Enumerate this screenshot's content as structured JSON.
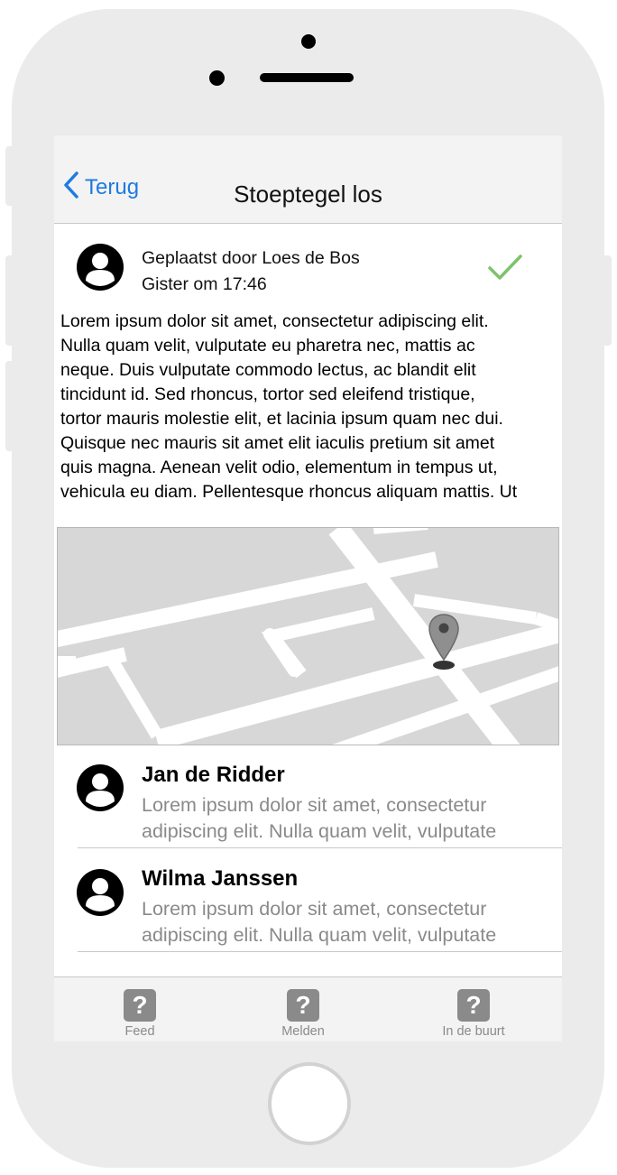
{
  "navbar": {
    "back_label": "Terug",
    "title": "Stoeptegel los"
  },
  "post": {
    "posted_by": "Geplaatst door Loes de Bos",
    "posted_at": "Gister om 17:46",
    "status": "resolved",
    "body_lines": [
      "Lorem ipsum dolor sit amet, consectetur adipiscing elit.",
      "Nulla quam velit, vulputate eu pharetra nec, mattis ac",
      "neque. Duis vulputate commodo lectus, ac blandit elit",
      "tincidunt id. Sed rhoncus, tortor sed eleifend tristique,",
      "tortor mauris molestie elit, et lacinia ipsum quam nec dui.",
      "Quisque nec mauris sit amet elit iaculis pretium sit amet",
      "quis magna. Aenean velit odio, elementum in tempus ut,",
      "vehicula eu diam. Pellentesque rhoncus aliquam mattis. Ut"
    ]
  },
  "comments": [
    {
      "name": "Jan de Ridder",
      "text_lines": [
        "Lorem ipsum dolor sit amet, consectetur",
        "adipiscing elit. Nulla quam velit, vulputate"
      ]
    },
    {
      "name": "Wilma Janssen",
      "text_lines": [
        "Lorem ipsum dolor sit amet, consectetur",
        "adipiscing elit. Nulla quam velit, vulputate"
      ]
    }
  ],
  "tabbar": {
    "tabs": [
      {
        "icon": "?",
        "label": "Feed"
      },
      {
        "icon": "?",
        "label": "Melden"
      },
      {
        "icon": "?",
        "label": "In de buurt"
      }
    ]
  },
  "colors": {
    "accent": "#1f7ae0",
    "check": "#7cc36a",
    "muted": "#8a8a8a",
    "device": "#ebebeb"
  },
  "icons": {
    "back": "chevron-left-icon",
    "avatar": "user-avatar-icon",
    "status": "checkmark-icon",
    "map_marker": "map-pin-icon",
    "tab": "question-mark-icon"
  }
}
